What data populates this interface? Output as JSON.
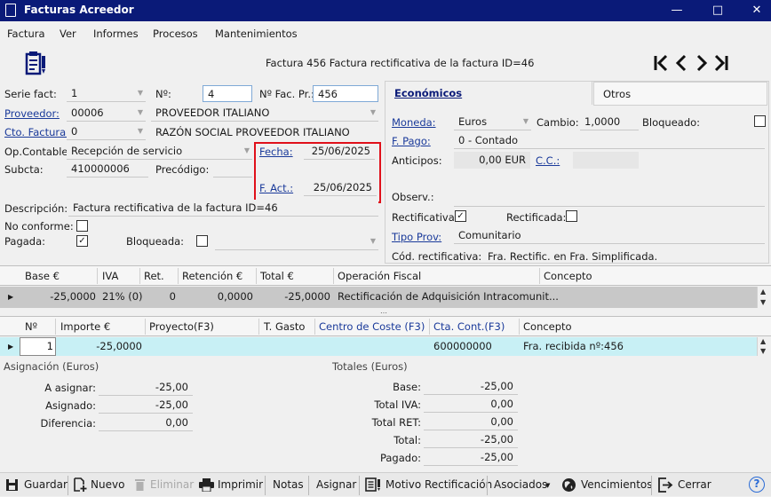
{
  "window": {
    "title": "Facturas Acreedor"
  },
  "menu": [
    "Factura",
    "Ver",
    "Informes",
    "Procesos",
    "Mantenimientos"
  ],
  "header": {
    "subtitle": "Factura 456 Factura rectificativa de la factura ID=46"
  },
  "form": {
    "serie_label": "Serie fact:",
    "serie_value": "1",
    "no_label": "Nº:",
    "no_value": "4",
    "nfacpr_label": "Nº Fac. Pr.:",
    "nfacpr_value": "456",
    "proveedor_label": "Proveedor:",
    "proveedor_value": "00006",
    "proveedor_name": "PROVEEDOR ITALIANO",
    "ctofactura_label": "Cto. Factura:",
    "ctofactura_value": "0",
    "razon_social": "RAZÓN SOCIAL PROVEEDOR ITALIANO",
    "opcontable_label": "Op.Contable:",
    "opcontable_value": "Recepción de servicio",
    "subcta_label": "Subcta:",
    "subcta_value": "410000006",
    "precodigo_label": "Precódigo:",
    "fecha_label": "Fecha:",
    "fecha_value": "25/06/2025",
    "fact_label": "F. Act.:",
    "fact_value": "25/06/2025",
    "descripcion_label": "Descripción:",
    "descripcion_value": "Factura rectificativa de la factura ID=46",
    "noconforme_label": "No conforme:",
    "pagada_label": "Pagada:",
    "bloqueada_label": "Bloqueada:"
  },
  "tabs": {
    "economicos": "Económicos",
    "otros": "Otros"
  },
  "economicos": {
    "moneda_label": "Moneda:",
    "moneda_value": "Euros",
    "cambio_label": "Cambio:",
    "cambio_value": "1,0000",
    "bloqueado_label": "Bloqueado:",
    "fpago_label": "F. Pago:",
    "fpago_value": "0 - Contado",
    "anticipos_label": "Anticipos:",
    "anticipos_value": "0,00 EUR",
    "cc_label": "C.C.:",
    "observ_label": "Observ.:",
    "rectificativa_label": "Rectificativa:",
    "rectificada_label": "Rectificada:",
    "tipoprov_label": "Tipo Prov:",
    "tipoprov_value": "Comunitario",
    "codrect_label": "Cód. rectificativa:",
    "codrect_value": "Fra. Rectific. en Fra. Simplificada."
  },
  "grid1": {
    "headers": [
      "Base €",
      "IVA",
      "Ret.",
      "Retención €",
      "Total €",
      "Operación Fiscal",
      "Concepto"
    ],
    "row": [
      "-25,0000",
      "21% (0)",
      "0",
      "0,0000",
      "-25,0000",
      "Rectificación de Adquisición Intracomunit...",
      ""
    ]
  },
  "grid2": {
    "headers": [
      "Nº",
      "Importe €",
      "Proyecto(F3)",
      "T. Gasto",
      "Centro de Coste (F3)",
      "Cta. Cont.(F3)",
      "Concepto"
    ],
    "row": [
      "1",
      "-25,0000",
      "",
      "",
      "",
      "600000000",
      "Fra. recibida nº:456"
    ]
  },
  "asignacion": {
    "title": "Asignación (Euros)",
    "a_asignar_label": "A asignar:",
    "a_asignar": "-25,00",
    "asignado_label": "Asignado:",
    "asignado": "-25,00",
    "diferencia_label": "Diferencia:",
    "diferencia": "0,00"
  },
  "totales": {
    "title": "Totales (Euros)",
    "base_label": "Base:",
    "base": "-25,00",
    "iva_label": "Total IVA:",
    "iva": "0,00",
    "ret_label": "Total RET:",
    "ret": "0,00",
    "total_label": "Total:",
    "total": "-25,00",
    "pagado_label": "Pagado:",
    "pagado": "-25,00"
  },
  "toolbar": {
    "guardar": "Guardar",
    "nuevo": "Nuevo",
    "eliminar": "Eliminar",
    "imprimir": "Imprimir",
    "notas": "Notas",
    "asignar": "Asignar",
    "motivo": "Motivo Rectificación",
    "asociados": "Asociados",
    "vencimientos": "Vencimientos",
    "cerrar": "Cerrar"
  }
}
